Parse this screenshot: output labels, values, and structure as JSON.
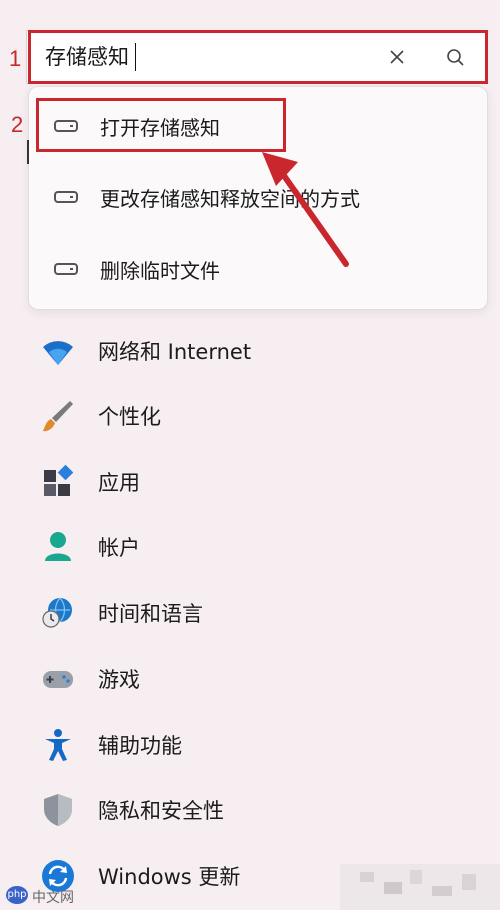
{
  "annotations": {
    "step1": "1",
    "step2": "2"
  },
  "search": {
    "value": "存储感知"
  },
  "suggestions": [
    {
      "label": "打开存储感知"
    },
    {
      "label": "更改存储感知释放空间的方式"
    },
    {
      "label": "删除临时文件"
    }
  ],
  "nav": [
    {
      "label": "网络和 Internet",
      "icon": "wifi-icon"
    },
    {
      "label": "个性化",
      "icon": "brush-icon"
    },
    {
      "label": "应用",
      "icon": "apps-icon"
    },
    {
      "label": "帐户",
      "icon": "account-icon"
    },
    {
      "label": "时间和语言",
      "icon": "globe-clock-icon"
    },
    {
      "label": "游戏",
      "icon": "gamepad-icon"
    },
    {
      "label": "辅助功能",
      "icon": "accessibility-icon"
    },
    {
      "label": "隐私和安全性",
      "icon": "shield-icon"
    },
    {
      "label": "Windows 更新",
      "icon": "update-icon"
    }
  ],
  "watermark": {
    "logo": "php",
    "text": "中文网"
  },
  "colors": {
    "highlight": "#c9272d",
    "accent": "#1a6fc9",
    "background": "#f6eef0"
  }
}
